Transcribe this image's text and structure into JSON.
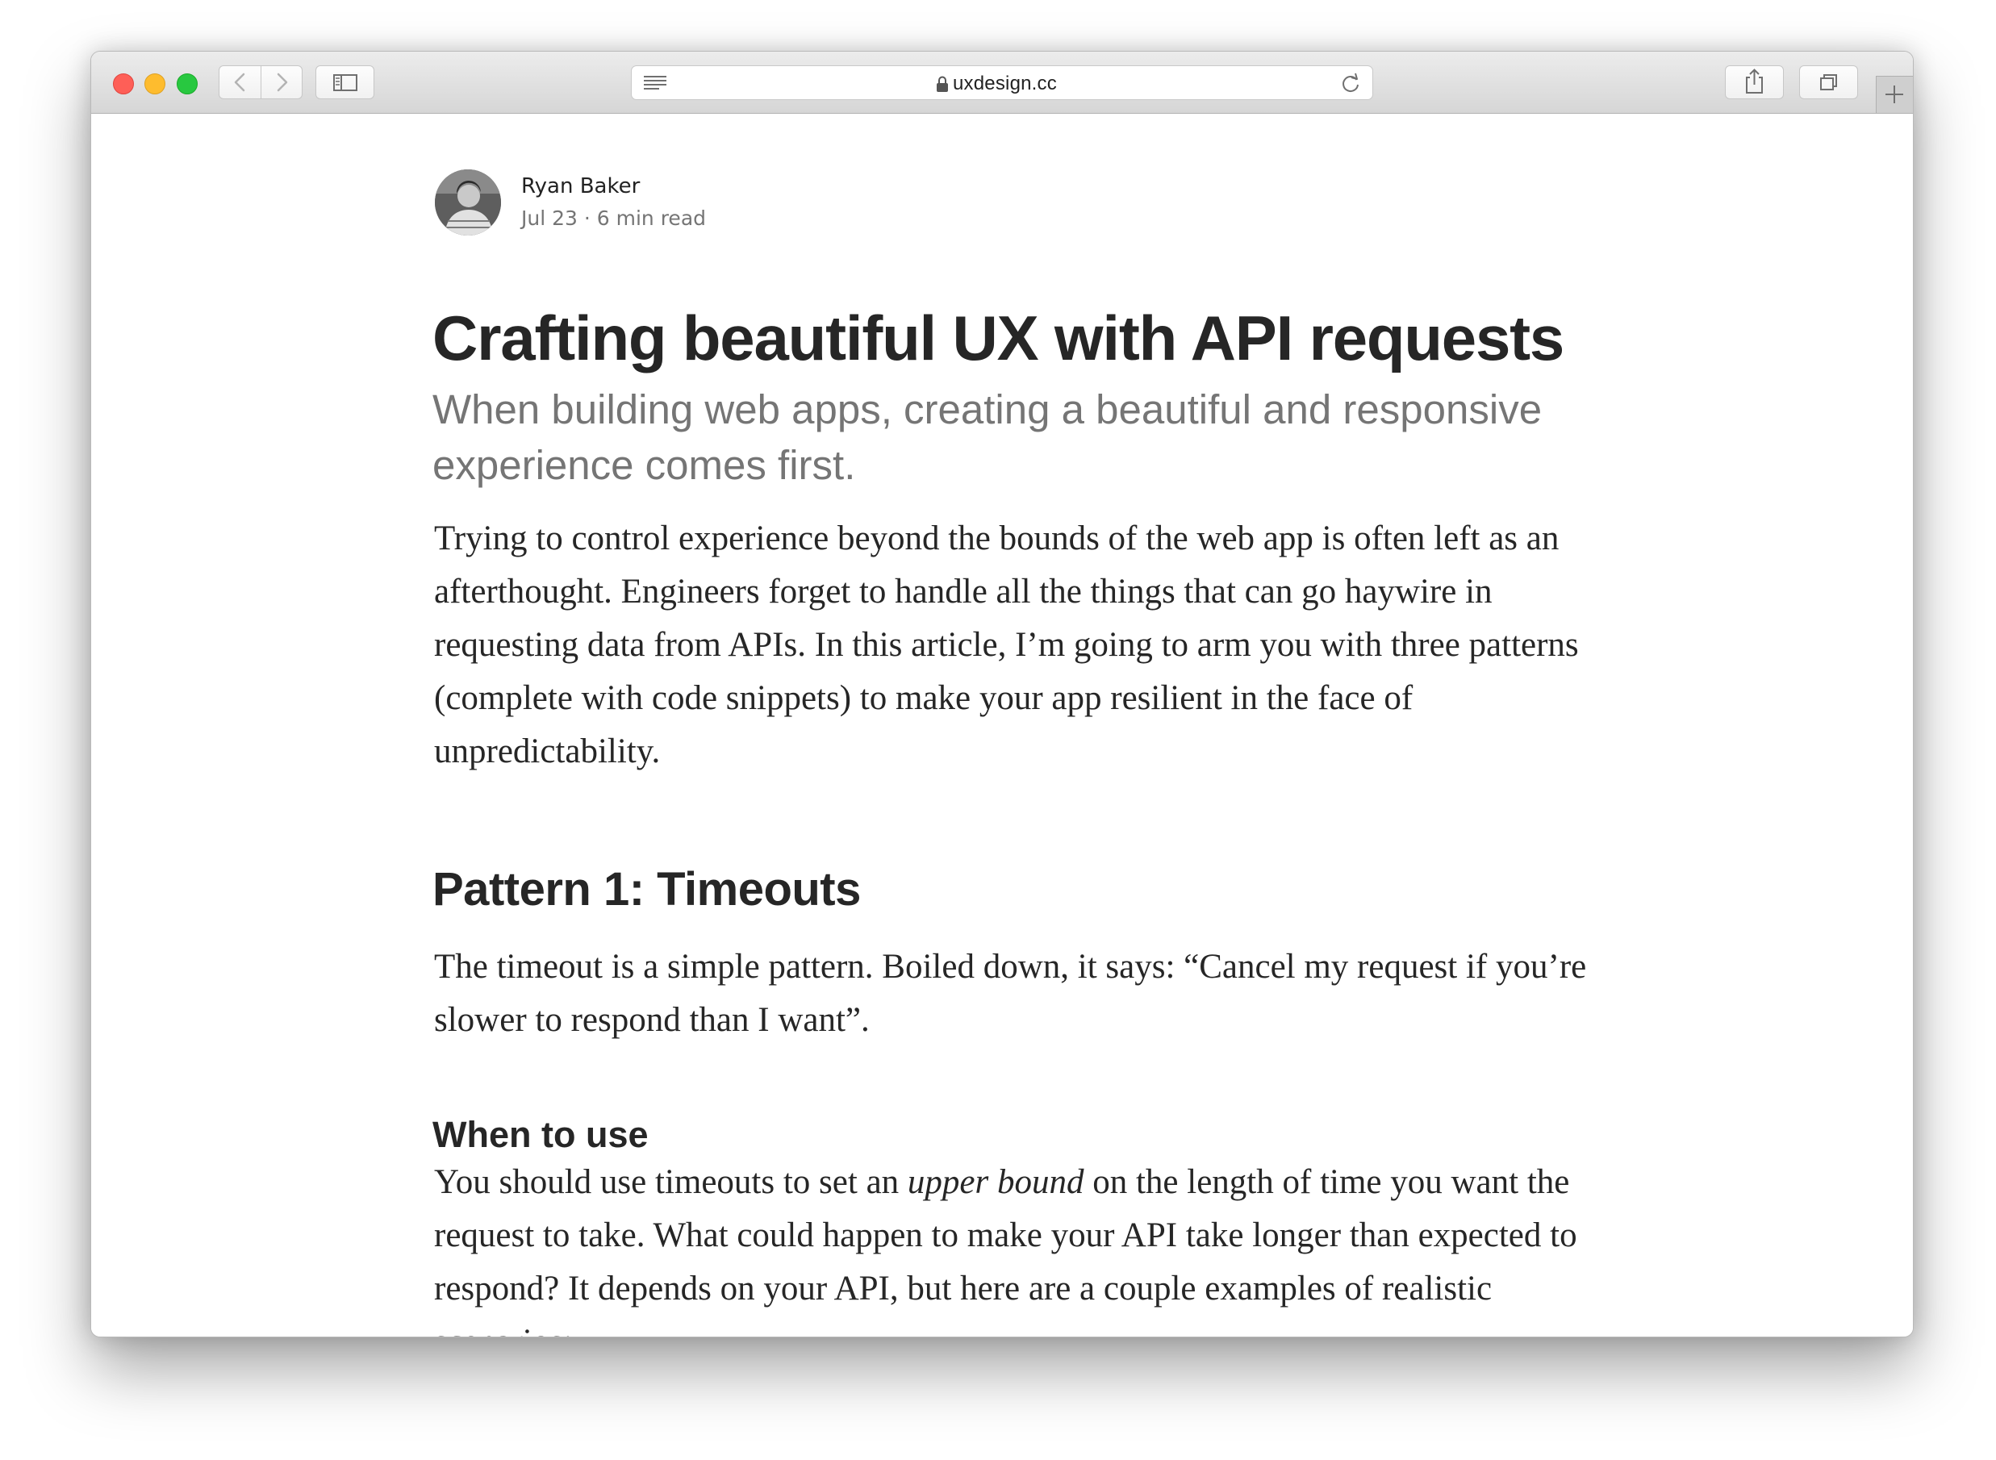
{
  "browser": {
    "url": "uxdesign.cc",
    "icons": {
      "back": "chevron-left-icon",
      "forward": "chevron-right-icon",
      "sidebar": "sidebar-icon",
      "reader": "reader-icon",
      "lock": "lock-icon",
      "reload": "reload-icon",
      "share": "share-icon",
      "tabs": "tabs-icon",
      "new_tab": "plus-icon"
    },
    "colors": {
      "close": "#fe5f57",
      "minimize": "#febc2e",
      "zoom": "#28c840"
    }
  },
  "article": {
    "author": {
      "name": "Ryan Baker",
      "meta": "Jul 23 · 6 min read"
    },
    "title": "Crafting beautiful UX with API requests",
    "subtitle": "When building web apps, creating a beautiful and responsive experience comes first.",
    "intro": "Trying to control experience beyond the bounds of the web app is often left as an afterthought. Engineers forget to handle all the things that can go haywire in requesting data from APIs. In this article, I’m going to arm you with three patterns (complete with code snippets) to make your app resilient in the face of unpredictability.",
    "section_heading": "Pattern 1: Timeouts",
    "section_text": "The timeout is a simple pattern. Boiled down, it says: “Cancel my request if you’re slower to respond than I want”.",
    "subsection_heading": "When to use",
    "subsection_text": {
      "before": "You should use timeouts to set an ",
      "emphasis": "upper bound",
      "after": " on the length of time you want the request to take. What could happen to make your API take longer than expected to respond? It depends on your API, but here are a couple examples of realistic scenarios:"
    }
  }
}
